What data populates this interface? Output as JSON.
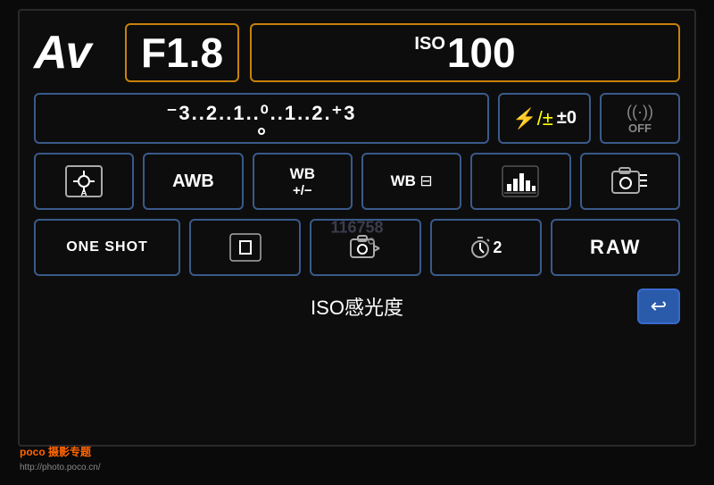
{
  "mode": "Av",
  "aperture": "F1.8",
  "iso_label": "ISO",
  "iso_value": "100",
  "exposure_scale": "⁻3..2..1..0..1..2.⁺3",
  "flash_icon": "⚡±",
  "flash_value": "±0",
  "wifi_label": "((·))\nOFF",
  "row3": [
    {
      "label": "☀A",
      "sub": ""
    },
    {
      "label": "AWB",
      "sub": ""
    },
    {
      "label": "WB\n+/−",
      "sub": ""
    },
    {
      "label": "WB⊟",
      "sub": ""
    },
    {
      "label": "📊",
      "sub": ""
    },
    {
      "label": "📷≡",
      "sub": ""
    }
  ],
  "row4": [
    {
      "label": "ONE SHOT"
    },
    {
      "label": "□"
    },
    {
      "label": "⊙"
    },
    {
      "label": "⏱2"
    },
    {
      "label": "RAW"
    }
  ],
  "bottom_label": "ISO感光度",
  "back_button": "↩",
  "watermark": "116758",
  "poco_line1": "poco 摄影专题",
  "poco_url": "http://photo.poco.cn/"
}
